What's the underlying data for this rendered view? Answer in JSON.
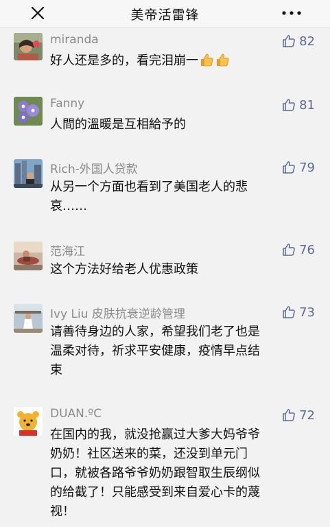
{
  "header": {
    "title": "美帝活雷锋"
  },
  "comments": [
    {
      "name": "miranda",
      "likes": "82",
      "text": "好人还是多的，看完泪崩一",
      "emoji": [
        "thumbs-up",
        "thumbs-up"
      ]
    },
    {
      "name": "Fanny",
      "likes": "81",
      "text": "人間的溫暖是互相給予的"
    },
    {
      "name": "Rich-外国人贷款",
      "likes": "79",
      "lines": [
        "从另一个方面也看到了美国老人的悲",
        "哀……"
      ]
    },
    {
      "name": "范海江",
      "likes": "76",
      "text": "这个方法好给老人优惠政策"
    },
    {
      "name": "Ivy Liu 皮肤抗衰逆龄管理",
      "likes": "73",
      "lines": [
        "请善待身边的人家，希望我们老了也是",
        "温柔对待，祈求平安健康，疫情早点结",
        "束"
      ]
    },
    {
      "name": "DUAN.ºC",
      "likes": "72",
      "lines": [
        "在国内的我，就没抢赢过大爹大妈爷爷",
        "奶奶！社区送来的菜，还没到单元门",
        "口，就被各路爷爷奶奶跟智取生辰纲似",
        "的给截了！只能感受到来自爱心卡的蔑",
        "视！"
      ]
    }
  ],
  "colors": {
    "accent": "#5b6b95",
    "name": "#8a8a8a",
    "text": "#111111",
    "background": "#f2f2f2"
  }
}
